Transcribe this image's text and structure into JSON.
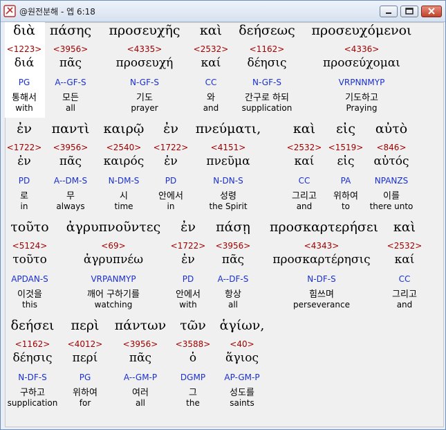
{
  "window": {
    "title": "@원전분해 - 엡 6:18"
  },
  "rows": [
    {
      "words": [
        {
          "greek": "διὰ",
          "num": "<1223>",
          "lex": "διά",
          "parse": "PG",
          "ko": "통해서",
          "en": "with"
        },
        {
          "greek": "πάσης",
          "num": "<3956>",
          "lex": "πᾶς",
          "parse": "A--GF-S",
          "ko": "모든",
          "en": "all"
        },
        {
          "greek": "προσευχῆς",
          "num": "<4335>",
          "lex": "προσευχή",
          "parse": "N-GF-S",
          "ko": "기도",
          "en": "prayer"
        },
        {
          "greek": "καὶ",
          "num": "<2532>",
          "lex": "καί",
          "parse": "CC",
          "ko": "와",
          "en": "and"
        },
        {
          "greek": "δεήσεως",
          "num": "<1162>",
          "lex": "δέησις",
          "parse": "N-GF-S",
          "ko": "간구로 하되",
          "en": "supplication"
        },
        {
          "greek": "προσευχόμενοι",
          "num": "<4336>",
          "lex": "προσεύχομαι",
          "parse": "VRPNNMYP",
          "ko": "기도하고",
          "en": "Praying"
        }
      ]
    },
    {
      "words": [
        {
          "greek": "ἐν",
          "num": "<1722>",
          "lex": "ἐν",
          "parse": "PD",
          "ko": "로",
          "en": "in"
        },
        {
          "greek": "παντὶ",
          "num": "<3956>",
          "lex": "πᾶς",
          "parse": "A--DM-S",
          "ko": "무",
          "en": "always"
        },
        {
          "greek": "καιρῷ",
          "num": "<2540>",
          "lex": "καιρός",
          "parse": "N-DM-S",
          "ko": "시",
          "en": "time"
        },
        {
          "greek": "ἐν",
          "num": "<1722>",
          "lex": "ἐν",
          "parse": "PD",
          "ko": "안에서",
          "en": "in"
        },
        {
          "greek": "πνεύματι,",
          "num": "<4151>",
          "lex": "πνεῦμα",
          "parse": "N-DN-S",
          "ko": "성령",
          "en": "the Spirit"
        },
        {
          "greek": "καὶ",
          "num": "<2532>",
          "lex": "καί",
          "parse": "CC",
          "ko": "그리고",
          "en": "and"
        },
        {
          "greek": "εἰς",
          "num": "<1519>",
          "lex": "εἰς",
          "parse": "PA",
          "ko": "위하여",
          "en": "to"
        },
        {
          "greek": "αὐτὸ",
          "num": "<846>",
          "lex": "αὐτός",
          "parse": "NPANZS",
          "ko": "이를",
          "en": "there unto"
        }
      ]
    },
    {
      "words": [
        {
          "greek": "τοῦτο",
          "num": "<5124>",
          "lex": "τοῦτο",
          "parse": "APDAN-S",
          "ko": "이것을",
          "en": "this"
        },
        {
          "greek": "ἀγρυπνοῦντες",
          "num": "<69>",
          "lex": "ἀγρυπνέω",
          "parse": "VRPANMYP",
          "ko": "깨어 구하기를",
          "en": "watching"
        },
        {
          "greek": "ἐν",
          "num": "<1722>",
          "lex": "ἐν",
          "parse": "PD",
          "ko": "안에서",
          "en": "with"
        },
        {
          "greek": "πάσῃ",
          "num": "<3956>",
          "lex": "πᾶς",
          "parse": "A--DF-S",
          "ko": "항상",
          "en": "all"
        },
        {
          "greek": "προσκαρτερήσει",
          "num": "<4343>",
          "lex": "προσκαρτέρησις",
          "parse": "N-DF-S",
          "ko": "힘쓰며",
          "en": "perseverance"
        },
        {
          "greek": "καὶ",
          "num": "<2532>",
          "lex": "καί",
          "parse": "CC",
          "ko": "그리고",
          "en": "and"
        }
      ]
    },
    {
      "words": [
        {
          "greek": "δεήσει",
          "num": "<1162>",
          "lex": "δέησις",
          "parse": "N-DF-S",
          "ko": "구하고",
          "en": "supplication"
        },
        {
          "greek": "περὶ",
          "num": "<4012>",
          "lex": "περί",
          "parse": "PG",
          "ko": "위하여",
          "en": "for"
        },
        {
          "greek": "πάντων",
          "num": "<3956>",
          "lex": "πᾶς",
          "parse": "A--GM-P",
          "ko": "여러",
          "en": "all"
        },
        {
          "greek": "τῶν",
          "num": "<3588>",
          "lex": "ὁ",
          "parse": "DGMP",
          "ko": "그",
          "en": "the"
        },
        {
          "greek": "ἁγίων,",
          "num": "<40>",
          "lex": "ἅγιος",
          "parse": "AP-GM-P",
          "ko": "성도를",
          "en": "saints"
        }
      ]
    }
  ]
}
